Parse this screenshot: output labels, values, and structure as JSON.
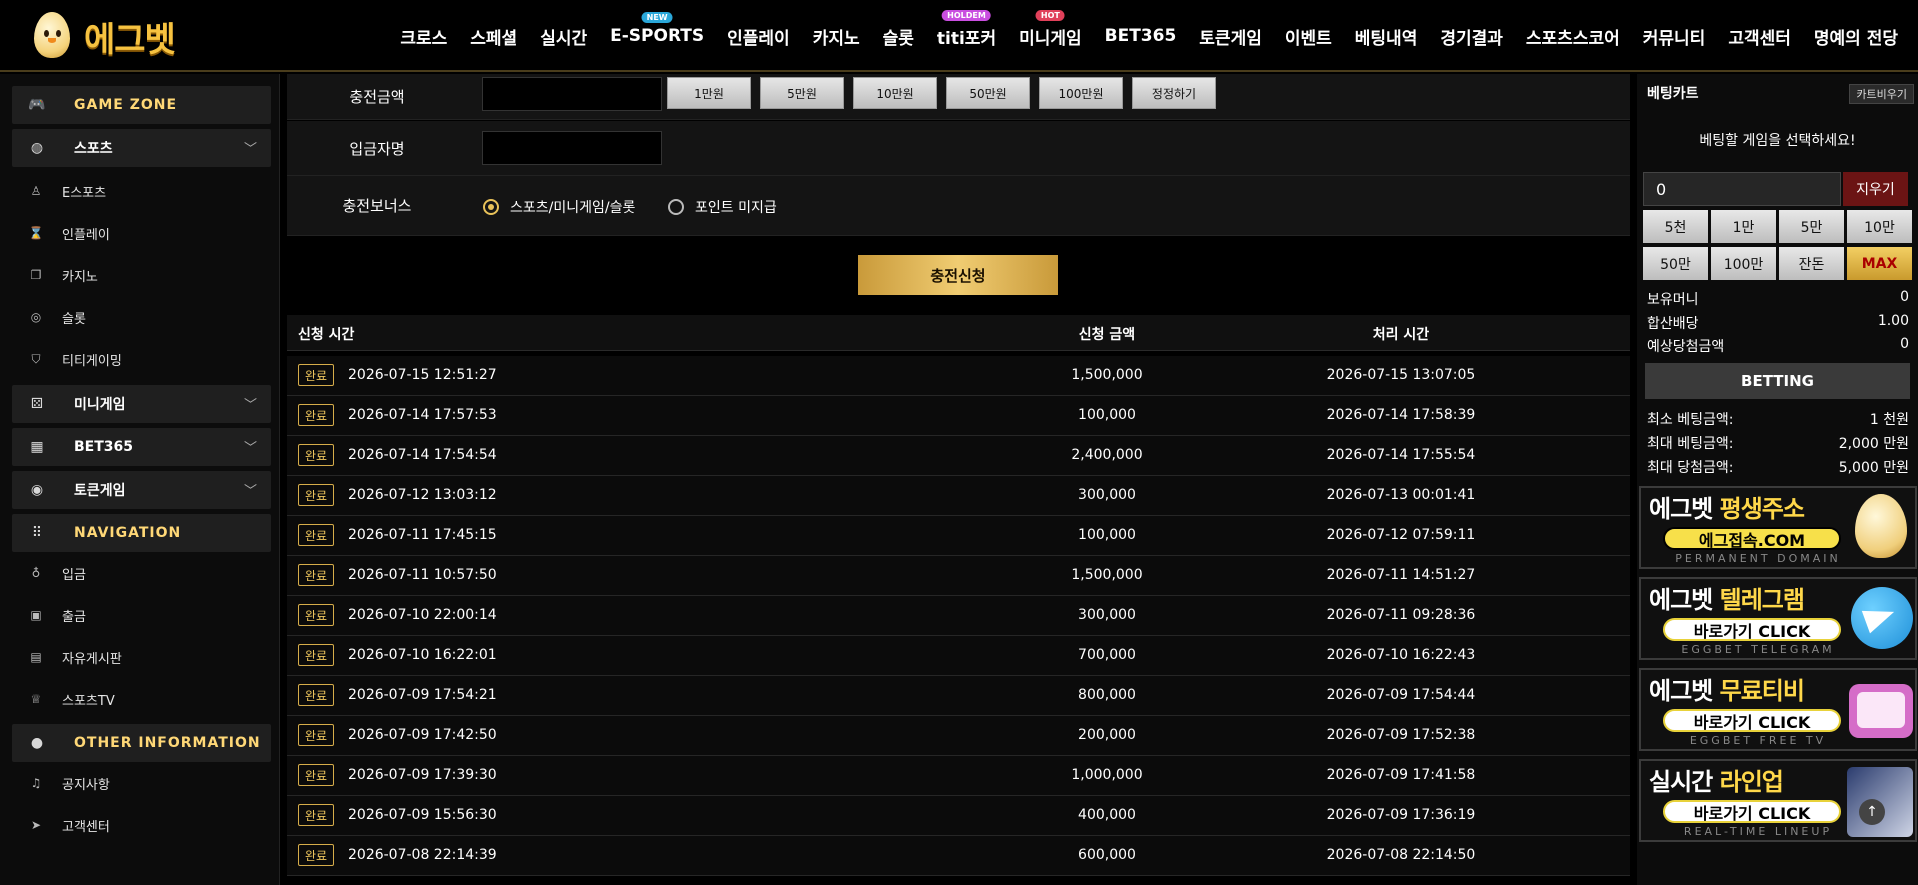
{
  "header": {
    "logo_text": "에그벳",
    "nav": [
      {
        "label": "크로스",
        "badge": ""
      },
      {
        "label": "스페셜",
        "badge": ""
      },
      {
        "label": "실시간",
        "badge": ""
      },
      {
        "label": "E-SPORTS",
        "badge": "NEW"
      },
      {
        "label": "인플레이",
        "badge": ""
      },
      {
        "label": "카지노",
        "badge": ""
      },
      {
        "label": "슬롯",
        "badge": ""
      },
      {
        "label": "titi포커",
        "badge": "HOLDEM"
      },
      {
        "label": "미니게임",
        "badge": "HOT"
      },
      {
        "label": "BET365",
        "badge": ""
      },
      {
        "label": "토큰게임",
        "badge": ""
      },
      {
        "label": "이벤트",
        "badge": ""
      },
      {
        "label": "베팅내역",
        "badge": ""
      },
      {
        "label": "경기결과",
        "badge": ""
      },
      {
        "label": "스포츠스코어",
        "badge": ""
      },
      {
        "label": "커뮤니티",
        "badge": ""
      },
      {
        "label": "고객센터",
        "badge": ""
      },
      {
        "label": "명예의 전당",
        "badge": ""
      }
    ]
  },
  "sidebar": {
    "game_zone": "GAME ZONE",
    "sports": "스포츠",
    "esports": "E스포츠",
    "inplay": "인플레이",
    "casino": "카지노",
    "slot": "슬롯",
    "titi": "티티게이밍",
    "minigame": "미니게임",
    "bet365": "BET365",
    "token": "토큰게임",
    "navigation": "NAVIGATION",
    "deposit": "입금",
    "withdraw": "출금",
    "board": "자유게시판",
    "sportstv": "스포츠TV",
    "other": "OTHER INFORMATION",
    "notice": "공지사항",
    "support": "고객센터"
  },
  "form": {
    "amount_label": "충전금액",
    "name_label": "입금자명",
    "bonus_label": "충전보너스",
    "amount_buttons": [
      "1만원",
      "5만원",
      "10만원",
      "50만원",
      "100만원",
      "정정하기"
    ],
    "bonus_opt1": "스포츠/미니게임/슬롯",
    "bonus_opt2": "포인트 미지급",
    "submit": "충전신청"
  },
  "table": {
    "col_req": "신청 시간",
    "col_amt": "신청 금액",
    "col_proc": "처리 시간",
    "rows": [
      {
        "status": "완료",
        "req": "2026-07-15 12:51:27",
        "amount": "1,500,000",
        "proc": "2026-07-15 13:07:05"
      },
      {
        "status": "완료",
        "req": "2026-07-14 17:57:53",
        "amount": "100,000",
        "proc": "2026-07-14 17:58:39"
      },
      {
        "status": "완료",
        "req": "2026-07-14 17:54:54",
        "amount": "2,400,000",
        "proc": "2026-07-14 17:55:54"
      },
      {
        "status": "완료",
        "req": "2026-07-12 13:03:12",
        "amount": "300,000",
        "proc": "2026-07-13 00:01:41"
      },
      {
        "status": "완료",
        "req": "2026-07-11 17:45:15",
        "amount": "100,000",
        "proc": "2026-07-12 07:59:11"
      },
      {
        "status": "완료",
        "req": "2026-07-11 10:57:50",
        "amount": "1,500,000",
        "proc": "2026-07-11 14:51:27"
      },
      {
        "status": "완료",
        "req": "2026-07-10 22:00:14",
        "amount": "300,000",
        "proc": "2026-07-11 09:28:36"
      },
      {
        "status": "완료",
        "req": "2026-07-10 16:22:01",
        "amount": "700,000",
        "proc": "2026-07-10 16:22:43"
      },
      {
        "status": "완료",
        "req": "2026-07-09 17:54:21",
        "amount": "800,000",
        "proc": "2026-07-09 17:54:44"
      },
      {
        "status": "완료",
        "req": "2026-07-09 17:42:50",
        "amount": "200,000",
        "proc": "2026-07-09 17:52:38"
      },
      {
        "status": "완료",
        "req": "2026-07-09 17:39:30",
        "amount": "1,000,000",
        "proc": "2026-07-09 17:41:58"
      },
      {
        "status": "완료",
        "req": "2026-07-09 15:56:30",
        "amount": "400,000",
        "proc": "2026-07-09 17:36:19"
      },
      {
        "status": "완료",
        "req": "2026-07-08 22:14:39",
        "amount": "600,000",
        "proc": "2026-07-08 22:14:50"
      }
    ]
  },
  "cart": {
    "title": "베팅카트",
    "clear": "카트비우기",
    "message": "베팅할 게임을 선택하세요!",
    "stake": "0",
    "delete": "지우기",
    "chips": [
      "5천",
      "1만",
      "5만",
      "10만",
      "50만",
      "100만",
      "잔돈",
      "MAX"
    ],
    "balance_label": "보유머니",
    "balance": "0",
    "odds_label": "합산배당",
    "odds": "1.00",
    "win_label": "예상당첨금액",
    "win": "0",
    "bet_button": "BETTING",
    "min_label": "최소 베팅금액:",
    "min": "1 천원",
    "max_label": "최대 베팅금액:",
    "max": "2,000 만원",
    "maxwin_label": "최대 당첨금액:",
    "maxwin": "5,000 만원"
  },
  "banners": [
    {
      "title_a": "에그벳 ",
      "title_b": "평생주소",
      "pill": "에그접속.COM",
      "sub": "PERMANENT DOMAIN"
    },
    {
      "title_a": "에그벳 ",
      "title_b": "텔레그램",
      "pill": "바로가기 CLICK",
      "sub": "EGGBET TELEGRAM"
    },
    {
      "title_a": "에그벳 ",
      "title_b": "무료티비",
      "pill": "바로가기 CLICK",
      "sub": "EGGBET FREE TV"
    },
    {
      "title_a": "실시간 ",
      "title_b": "라인업",
      "pill": "바로가기 CLICK",
      "sub": "REAL-TIME LINEUP"
    }
  ],
  "colors": {
    "accent_gold": "#f0c75d",
    "danger": "#6b1414",
    "background": "#000000"
  }
}
